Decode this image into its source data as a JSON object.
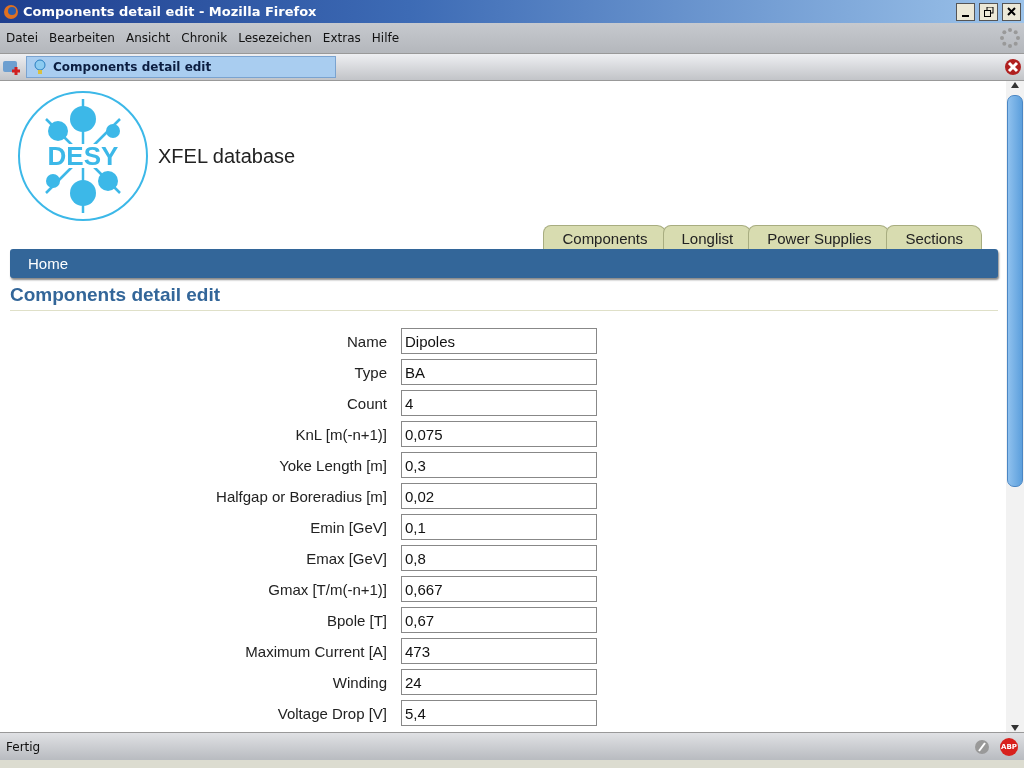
{
  "window": {
    "title": "Components detail edit - Mozilla Firefox"
  },
  "menu": [
    {
      "label": "Datei"
    },
    {
      "label": "Bearbeiten"
    },
    {
      "label": "Ansicht"
    },
    {
      "label": "Chronik"
    },
    {
      "label": "Lesezeichen"
    },
    {
      "label": "Extras"
    },
    {
      "label": "Hilfe"
    }
  ],
  "browser_tab": {
    "title": "Components detail edit"
  },
  "header": {
    "logo_text": "DESY",
    "site_title": "XFEL database"
  },
  "tabs": [
    {
      "label": "Components"
    },
    {
      "label": "Longlist"
    },
    {
      "label": "Power Supplies"
    },
    {
      "label": "Sections"
    }
  ],
  "nav_bar": {
    "link": "Home"
  },
  "page_title": "Components detail edit",
  "fields": [
    {
      "label": "Name",
      "value": "Dipoles"
    },
    {
      "label": "Type",
      "value": "BA"
    },
    {
      "label": "Count",
      "value": "4"
    },
    {
      "label": "KnL [m(-n+1)]",
      "value": "0,075"
    },
    {
      "label": "Yoke Length [m]",
      "value": "0,3"
    },
    {
      "label": "Halfgap or Boreradius [m]",
      "value": "0,02"
    },
    {
      "label": "Emin [GeV]",
      "value": "0,1"
    },
    {
      "label": "Emax [GeV]",
      "value": "0,8"
    },
    {
      "label": "Gmax [T/m(-n+1)]",
      "value": "0,667"
    },
    {
      "label": "Bpole [T]",
      "value": "0,67"
    },
    {
      "label": "Maximum Current [A]",
      "value": "473"
    },
    {
      "label": "Winding",
      "value": "24"
    },
    {
      "label": "Voltage Drop [V]",
      "value": "5,4"
    }
  ],
  "status_bar": {
    "text": "Fertig",
    "badge": "ABP"
  }
}
